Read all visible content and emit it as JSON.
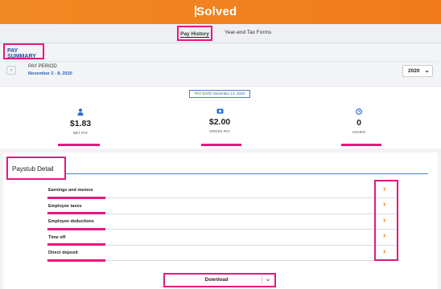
{
  "header": {
    "logo_text": "Solved"
  },
  "tabs": [
    {
      "label": "Pay History",
      "active": true
    },
    {
      "label": "Year-end Tax Forms",
      "active": false
    }
  ],
  "summary": {
    "title": "PAY SUMMARY",
    "prev_icon": "chevron-left-icon",
    "period_label": "PAY PERIOD",
    "period_value": "November 2 - 8, 2020",
    "year": "2020"
  },
  "pay_date": "PAY DATE  November 13, 2020",
  "stats": [
    {
      "icon": "person-icon",
      "value": "$1.83",
      "label": "NET PAY"
    },
    {
      "icon": "money-icon",
      "value": "$2.00",
      "label": "GROSS PAY"
    },
    {
      "icon": "clock-icon",
      "value": "0",
      "label": "HOURS"
    }
  ],
  "detail": {
    "title": "Paystub Detail",
    "rows": [
      {
        "label": "Earnings and memos"
      },
      {
        "label": "Employee taxes"
      },
      {
        "label": "Employee deductions"
      },
      {
        "label": "Time off"
      },
      {
        "label": "Direct deposit"
      }
    ]
  },
  "download": {
    "label": "Download"
  },
  "colors": {
    "brand_orange": "#f07a1a",
    "highlight_pink": "#e5187f",
    "link_blue": "#2c5fb4"
  }
}
